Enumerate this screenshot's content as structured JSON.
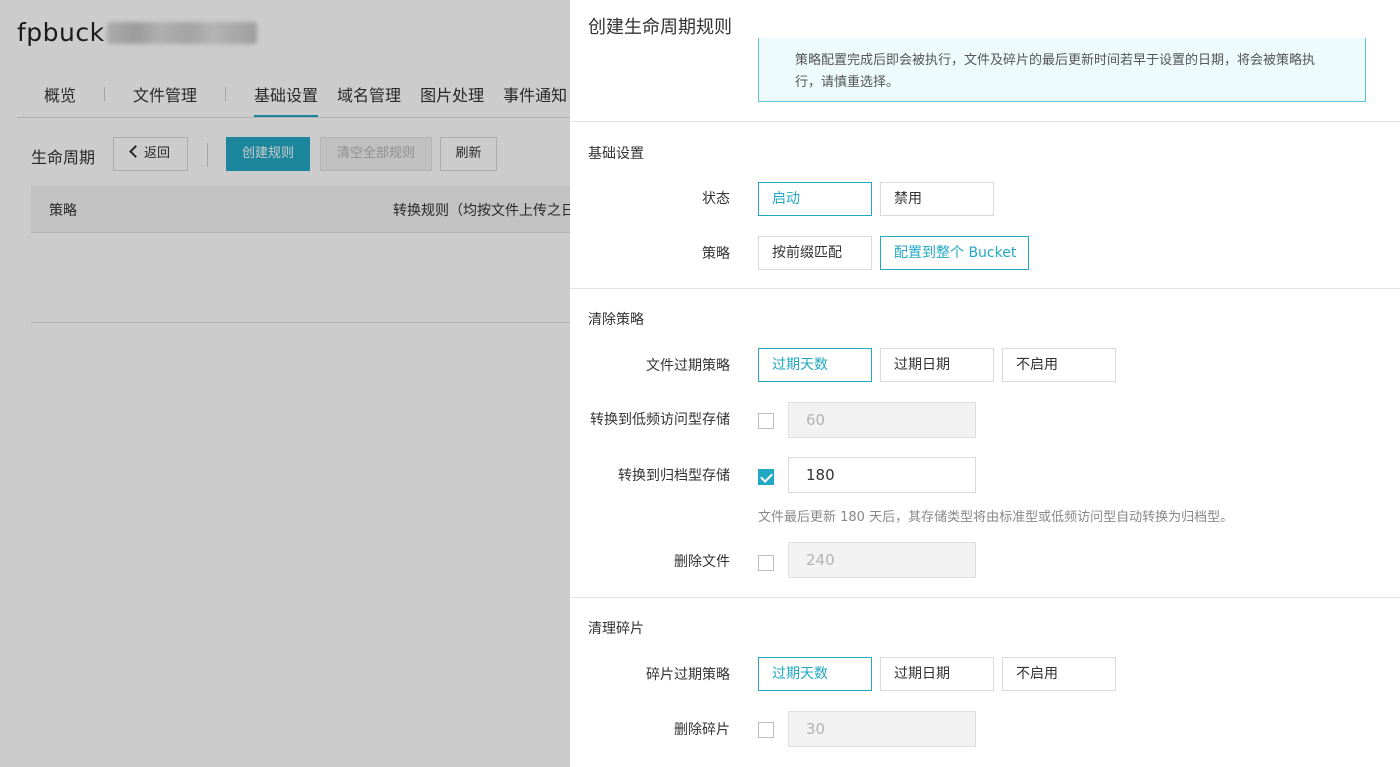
{
  "console": {
    "bucket_name_visible": "fpbuck",
    "tabs": [
      {
        "label": "概览"
      },
      {
        "label": "文件管理"
      },
      {
        "label": "基础设置"
      },
      {
        "label": "域名管理"
      },
      {
        "label": "图片处理"
      },
      {
        "label": "事件通知"
      }
    ],
    "active_tab": "基础设置",
    "lifecycle_label": "生命周期",
    "back_button": "返回",
    "create_rule_button": "创建规则",
    "clear_all_button": "清空全部规则",
    "refresh_button": "刷新",
    "table_headers": [
      "策略",
      "转换规则（均按文件上传之日"
    ]
  },
  "panel": {
    "title": "创建生命周期规则",
    "notice": "策略配置完成后即会被执行，文件及碎片的最后更新时间若早于设置的日期，将会被策略执行，请慎重选择。",
    "basic": {
      "section_title": "基础设置",
      "status_label": "状态",
      "status_options": [
        "启动",
        "禁用"
      ],
      "status_selected": "启动",
      "policy_label": "策略",
      "policy_options": [
        "按前缀匹配",
        "配置到整个 Bucket"
      ],
      "policy_selected": "配置到整个 Bucket"
    },
    "cleanup": {
      "section_title": "清除策略",
      "expire_label": "文件过期策略",
      "expire_options": [
        "过期天数",
        "过期日期",
        "不启用"
      ],
      "expire_selected": "过期天数",
      "ia_label": "转换到低频访问型存储",
      "ia_checked": false,
      "ia_days": "60",
      "archive_label": "转换到归档型存储",
      "archive_checked": true,
      "archive_days": "180",
      "archive_hint": "文件最后更新 180 天后，其存储类型将由标准型或低频访问型自动转换为归档型。",
      "delete_label": "删除文件",
      "delete_checked": false,
      "delete_days": "240"
    },
    "fragments": {
      "section_title": "清理碎片",
      "expire_label": "碎片过期策略",
      "expire_options": [
        "过期天数",
        "过期日期",
        "不启用"
      ],
      "expire_selected": "过期天数",
      "delete_label": "删除碎片",
      "delete_checked": false,
      "delete_days": "30"
    }
  },
  "colors": {
    "accent": "#22a8c3",
    "notice_bg": "#eefbfc",
    "overlay": "rgba(0,0,0,0.2)"
  }
}
